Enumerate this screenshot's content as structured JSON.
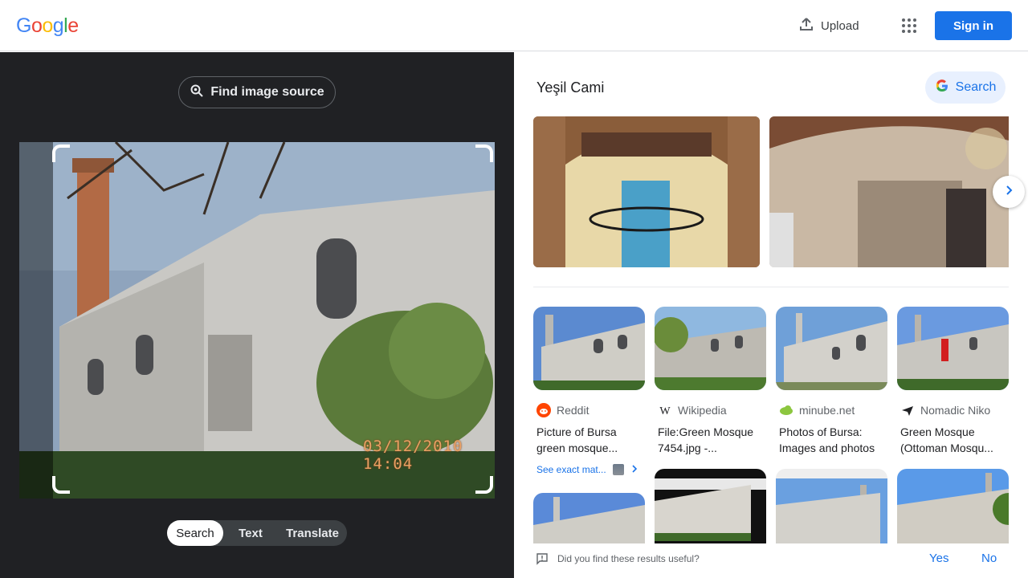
{
  "header": {
    "logo_letters": [
      "G",
      "o",
      "o",
      "g",
      "l",
      "e"
    ],
    "logo_colors": [
      "#4285f4",
      "#ea4335",
      "#fbbc05",
      "#4285f4",
      "#34a853",
      "#ea4335"
    ],
    "upload_label": "Upload",
    "upload_icon": "upload-icon",
    "apps_icon": "apps-grid-icon",
    "signin_label": "Sign in"
  },
  "left_panel": {
    "find_source_label": "Find image source",
    "find_source_icon": "lens-search-icon",
    "photo_stamp": "03/12/2010 14:04",
    "modes": [
      "Search",
      "Text",
      "Translate"
    ],
    "active_mode": "Search"
  },
  "right_panel": {
    "entity_title": "Yeşil Cami",
    "entity_search_label": "Search",
    "carousel_next_icon": "chevron-right-icon",
    "results": [
      {
        "source": "Reddit",
        "source_icon": "reddit-icon",
        "title": "Picture of Bursa",
        "title2": "green mosque...",
        "exact_match": "See exact mat..."
      },
      {
        "source": "Wikipedia",
        "source_icon": "wikipedia-icon",
        "title": "File:Green Mosque",
        "title2": "7454.jpg -..."
      },
      {
        "source": "minube.net",
        "source_icon": "minube-icon",
        "title": "Photos of Bursa:",
        "title2": "Images and photos"
      },
      {
        "source": "Nomadic Niko",
        "source_icon": "plane-icon",
        "title": "Green Mosque",
        "title2": "(Ottoman Mosqu..."
      }
    ],
    "feedback": {
      "question": "Did you find these results useful?",
      "yes_label": "Yes",
      "no_label": "No"
    }
  }
}
